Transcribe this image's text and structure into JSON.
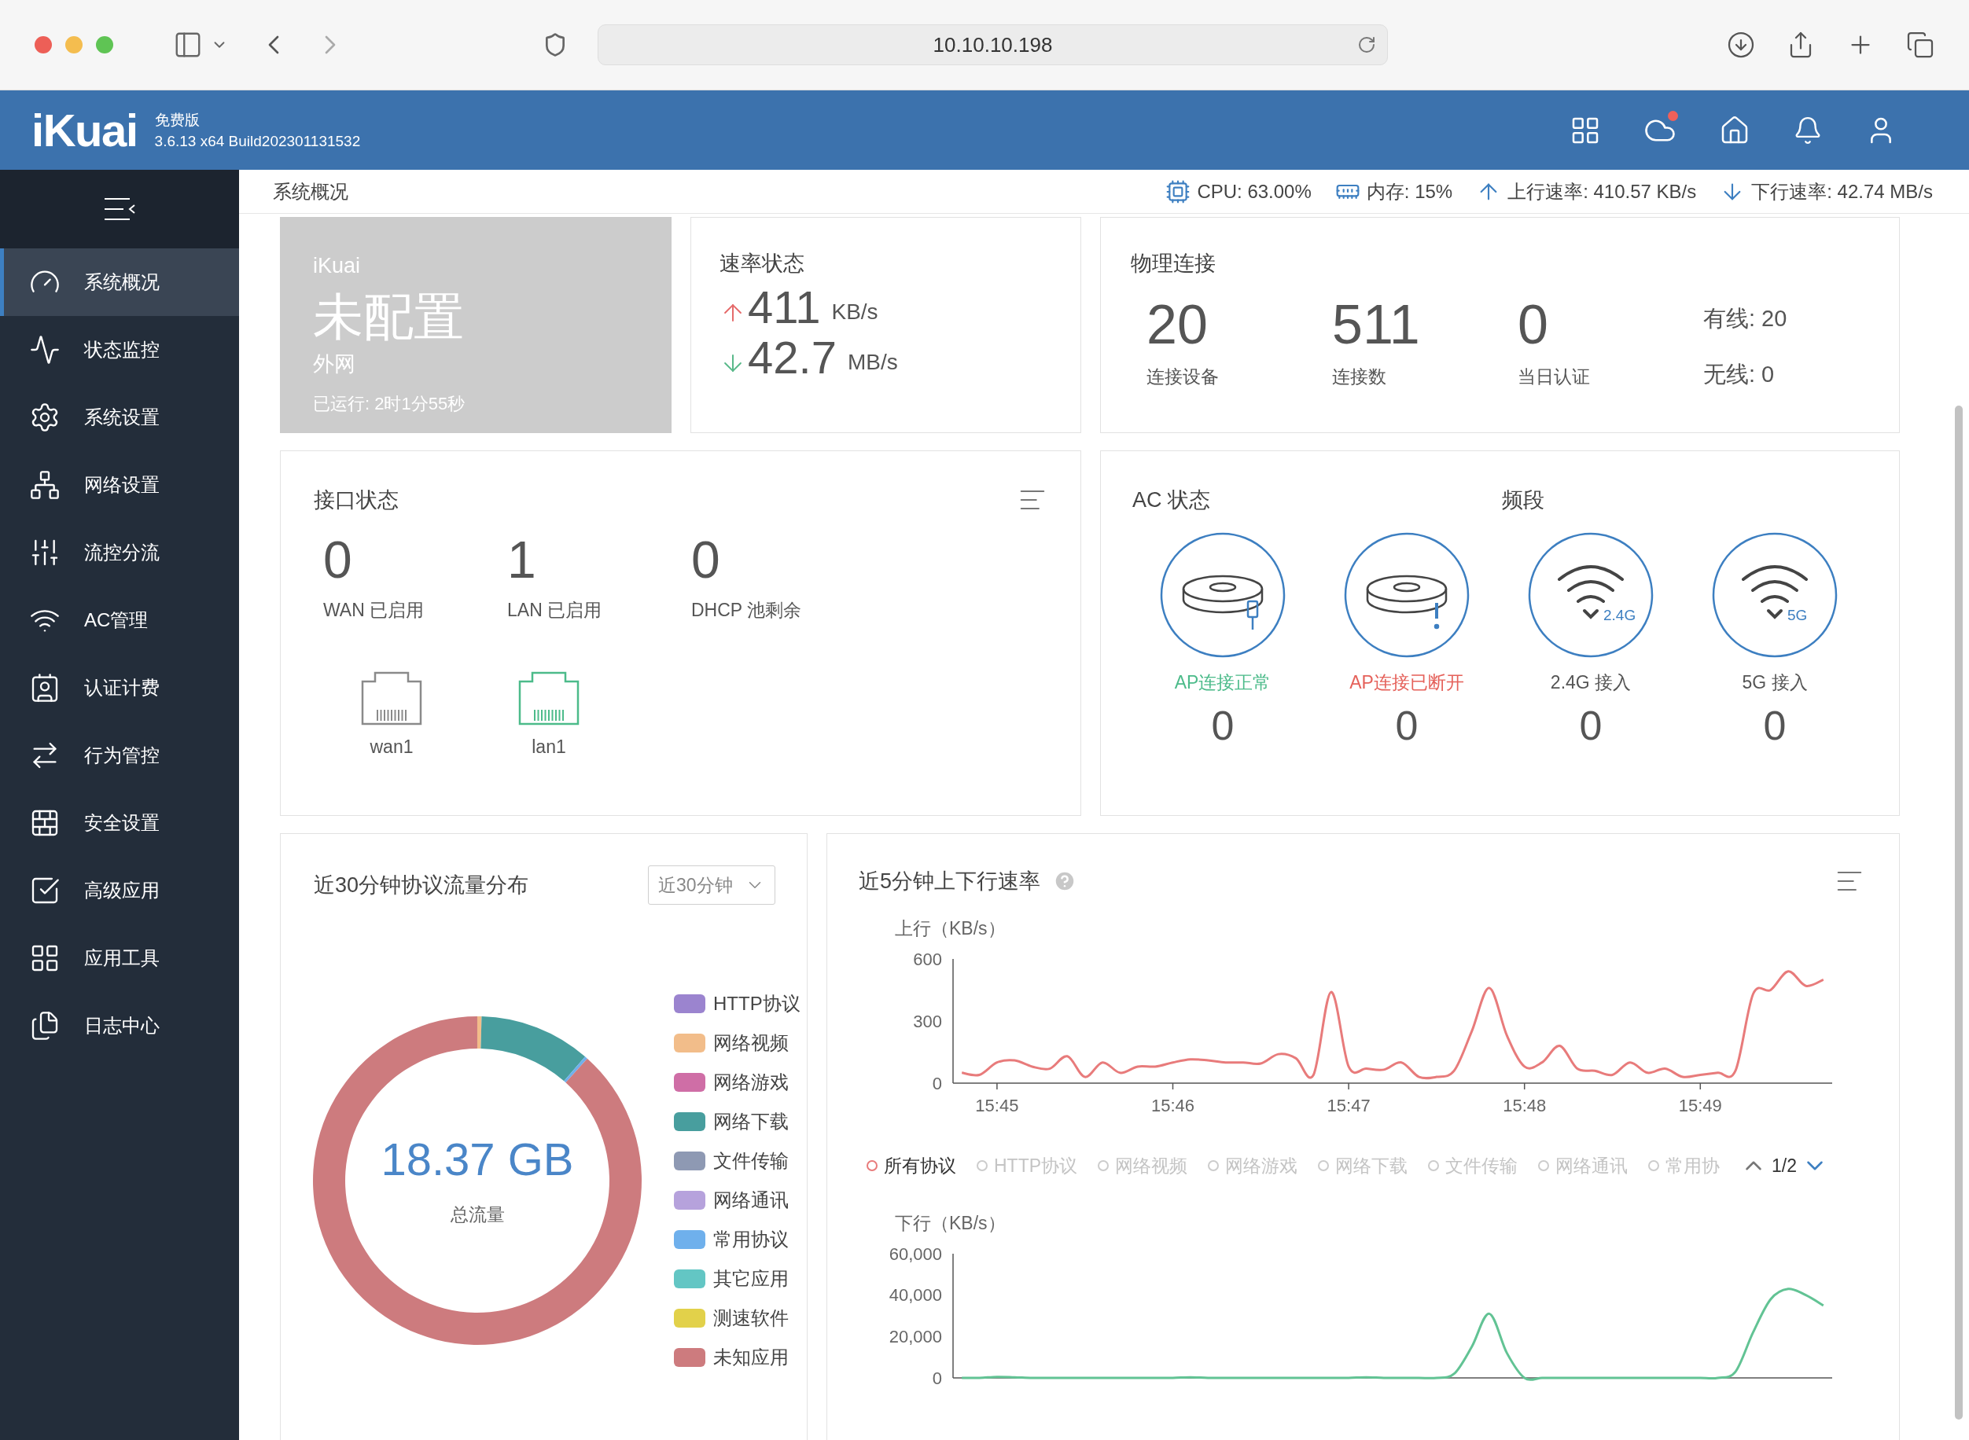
{
  "browser": {
    "url": "10.10.10.198"
  },
  "header": {
    "logo": "iKuai",
    "edition": "免费版",
    "version": "3.6.13 x64 Build202301131532",
    "cloud_alert": true
  },
  "sidebar": {
    "items": [
      {
        "label": "系统概况",
        "kind": "gauge",
        "selected": true
      },
      {
        "label": "状态监控",
        "kind": "pulse",
        "selected": false
      },
      {
        "label": "系统设置",
        "kind": "gear",
        "selected": false
      },
      {
        "label": "网络设置",
        "kind": "network",
        "selected": false
      },
      {
        "label": "流控分流",
        "kind": "sliders",
        "selected": false
      },
      {
        "label": "AC管理",
        "kind": "wifi",
        "selected": false
      },
      {
        "label": "认证计费",
        "kind": "card",
        "selected": false
      },
      {
        "label": "行为管控",
        "kind": "arrows",
        "selected": false
      },
      {
        "label": "安全设置",
        "kind": "wall",
        "selected": false
      },
      {
        "label": "高级应用",
        "kind": "check",
        "selected": false
      },
      {
        "label": "应用工具",
        "kind": "apps",
        "selected": false
      },
      {
        "label": "日志中心",
        "kind": "files",
        "selected": false
      }
    ]
  },
  "page_title": "系统概况",
  "status": [
    {
      "kind": "cpu",
      "text": "CPU: 63.00%"
    },
    {
      "kind": "memory",
      "text": "内存: 15%"
    },
    {
      "kind": "up",
      "text": "上行速率: 410.57 KB/s"
    },
    {
      "kind": "down",
      "text": "下行速率: 42.74 MB/s"
    }
  ],
  "overview": {
    "brand": "iKuai",
    "status": "未配置",
    "network": "外网",
    "uptime": "已运行: 2时1分55秒"
  },
  "rate": {
    "title": "速率状态",
    "rows": [
      {
        "kind": "up",
        "value": "411",
        "unit": "KB/s"
      },
      {
        "kind": "down",
        "value": "42.7",
        "unit": "MB/s"
      }
    ]
  },
  "physical": {
    "title": "物理连接",
    "stats": [
      {
        "value": "20",
        "label": "连接设备"
      },
      {
        "value": "511",
        "label": "连接数"
      },
      {
        "value": "0",
        "label": "当日认证"
      }
    ],
    "side": [
      "有线: 20",
      "无线: 0"
    ]
  },
  "interfaces": {
    "title": "接口状态",
    "stats": [
      {
        "value": "0",
        "label": "WAN 已启用"
      },
      {
        "value": "1",
        "label": "LAN 已启用"
      },
      {
        "value": "0",
        "label": "DHCP 池剩余"
      }
    ],
    "ports": [
      {
        "name": "wan1",
        "connected": false
      },
      {
        "name": "lan1",
        "connected": true
      }
    ]
  },
  "ac": {
    "title": "AC 状态",
    "band_title": "频段",
    "items": [
      {
        "kind": "ap_ok",
        "label": "AP连接正常",
        "color": "#4cbb8a",
        "value": "0"
      },
      {
        "kind": "ap_lost",
        "label": "AP连接已断开",
        "color": "#e5615a",
        "value": "0"
      },
      {
        "kind": "wifi",
        "band": "2.4G",
        "label": "2.4G 接入",
        "color": "#555555",
        "value": "0"
      },
      {
        "kind": "wifi",
        "band": "5G",
        "label": "5G 接入",
        "color": "#555555",
        "value": "0"
      }
    ]
  },
  "protocol": {
    "title": "近30分钟协议流量分布",
    "range": "近30分钟",
    "total": "18.37 GB",
    "total_label": "总流量",
    "legend": [
      {
        "label": "HTTP协议",
        "color": "#9b84cf"
      },
      {
        "label": "网络视频",
        "color": "#f2bd8a"
      },
      {
        "label": "网络游戏",
        "color": "#cf6ea6"
      },
      {
        "label": "网络下载",
        "color": "#489e9e"
      },
      {
        "label": "文件传输",
        "color": "#8e99b3"
      },
      {
        "label": "网络通讯",
        "color": "#b6a2dc"
      },
      {
        "label": "常用协议",
        "color": "#6fb0ec"
      },
      {
        "label": "其它应用",
        "color": "#63c6c4"
      },
      {
        "label": "测速软件",
        "color": "#e2d14a"
      },
      {
        "label": "未知应用",
        "color": "#cd7b7e"
      }
    ]
  },
  "speed": {
    "title": "近5分钟上下行速率",
    "upload": {
      "chart_data": {
        "type": "line",
        "ylabel": "上行（KB/s）",
        "ylim": [
          0,
          600
        ],
        "yticks": [
          0,
          300,
          600
        ],
        "categories": [
          null,
          null,
          "15:45",
          null,
          null,
          null,
          null,
          null,
          null,
          null,
          null,
          null,
          "15:46",
          null,
          null,
          null,
          null,
          null,
          null,
          null,
          null,
          null,
          "15:47",
          null,
          null,
          null,
          null,
          null,
          null,
          null,
          null,
          null,
          "15:48",
          null,
          null,
          null,
          null,
          null,
          null,
          null,
          null,
          null,
          "15:49",
          null,
          null,
          null,
          null,
          null,
          null,
          null
        ],
        "series": [
          {
            "color": "#e87b7b",
            "values": [
              50,
              40,
              100,
              110,
              80,
              70,
              130,
              30,
              100,
              50,
              80,
              80,
              100,
              115,
              110,
              100,
              100,
              95,
              140,
              120,
              40,
              440,
              80,
              70,
              65,
              100,
              30,
              30,
              60,
              250,
              460,
              230,
              80,
              100,
              180,
              70,
              60,
              40,
              100,
              50,
              70,
              30,
              40,
              50,
              60,
              430,
              450,
              540,
              470,
              500
            ]
          }
        ]
      }
    },
    "legend": [
      {
        "label": "所有协议",
        "selected": true
      },
      {
        "label": "HTTP协议",
        "selected": false
      },
      {
        "label": "网络视频",
        "selected": false
      },
      {
        "label": "网络游戏",
        "selected": false
      },
      {
        "label": "网络下载",
        "selected": false
      },
      {
        "label": "文件传输",
        "selected": false
      },
      {
        "label": "网络通讯",
        "selected": false
      },
      {
        "label": "常用协",
        "selected": false
      }
    ],
    "pager": {
      "page": "1/2",
      "prev_disabled": true,
      "next_disabled": false
    },
    "download": {
      "chart_data": {
        "type": "line",
        "categories": [
          null,
          null,
          null,
          null,
          null,
          null,
          null,
          null,
          null,
          null,
          null,
          null,
          null,
          null,
          null,
          null,
          null,
          null,
          null,
          null,
          null,
          null,
          null,
          null,
          null,
          null,
          null,
          null,
          null,
          null,
          null,
          null,
          null,
          null,
          null,
          null,
          null,
          null,
          null,
          null,
          null,
          null,
          null,
          null,
          null,
          null,
          null,
          null,
          null,
          null
        ],
        "ylabel": "下行（KB/s）",
        "ylim": [
          0,
          60000
        ],
        "yticks": [
          0,
          {
            "value": 20000,
            "label": "20,000"
          },
          {
            "value": 40000,
            "label": "40,000"
          },
          {
            "value": 60000,
            "label": "60,000"
          }
        ],
        "series": [
          {
            "color": "#62c394",
            "values": [
              0,
              0,
              500,
              300,
              0,
              0,
              0,
              0,
              0,
              0,
              0,
              0,
              0,
              300,
              0,
              0,
              0,
              0,
              0,
              0,
              0,
              0,
              0,
              300,
              0,
              0,
              0,
              0,
              2000,
              15000,
              31000,
              12000,
              0,
              0,
              0,
              0,
              0,
              0,
              0,
              0,
              0,
              0,
              0,
              0,
              3000,
              22000,
              38000,
              43000,
              40000,
              35000
            ]
          }
        ]
      }
    }
  }
}
